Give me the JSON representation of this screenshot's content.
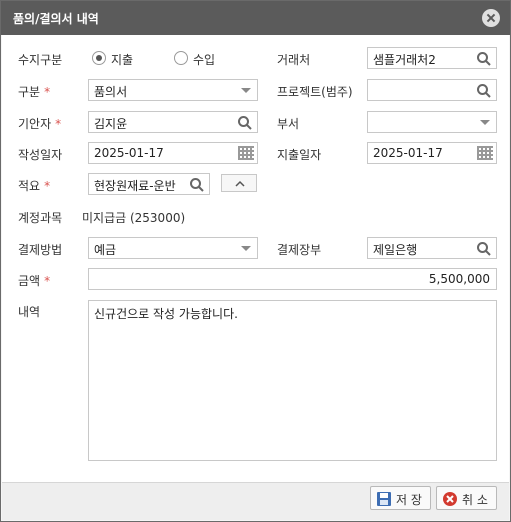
{
  "window": {
    "title": "품의/결의서 내역"
  },
  "form": {
    "type_label": "수지구분",
    "type_options": [
      "지출",
      "수입"
    ],
    "type_selected": "지출",
    "client_label": "거래처",
    "client_value": "샘플거래처2",
    "category_label": "구분",
    "category_value": "품의서",
    "project_label": "프로젝트(범주)",
    "project_value": "",
    "drafter_label": "기안자",
    "drafter_value": "김지윤",
    "dept_label": "부서",
    "dept_value": "",
    "date_label": "작성일자",
    "date_value": "2025-01-17",
    "expense_date_label": "지출일자",
    "expense_date_value": "2025-01-17",
    "summary_label": "적요",
    "summary_value": "현장원재료-운반",
    "account_label": "계정과목",
    "account_value": "미지급금 (253000)",
    "method_label": "결제방법",
    "method_value": "예금",
    "book_label": "결제장부",
    "book_value": "제일은행",
    "amount_label": "금액",
    "amount_value": "5,500,000",
    "detail_label": "내역",
    "detail_value": "신규건으로 작성 가능합니다."
  },
  "buttons": {
    "save": "저 장",
    "cancel": "취 소"
  },
  "required_mark": "*"
}
